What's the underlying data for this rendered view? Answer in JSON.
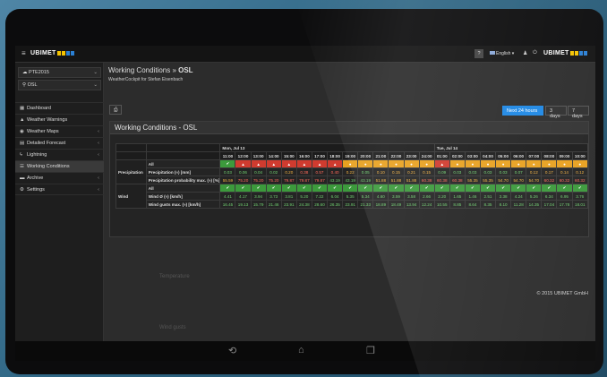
{
  "topbar": {
    "menu_icon": "menu-icon",
    "logo_text": "UBIMET",
    "help_label": "?",
    "language": "English",
    "footer_logo": "UBIMET"
  },
  "sidebar": {
    "select1": "PTE2015",
    "select2": "OSL",
    "items": [
      {
        "label": "Dashboard",
        "icon": "grid-icon"
      },
      {
        "label": "Weather Warnings",
        "icon": "warning-icon"
      },
      {
        "label": "Weather Maps",
        "icon": "globe-icon"
      },
      {
        "label": "Detailed Forecast",
        "icon": "calendar-icon"
      },
      {
        "label": "Lightning",
        "icon": "lightning-icon"
      },
      {
        "label": "Working Conditions",
        "icon": "list-icon"
      },
      {
        "label": "Archive",
        "icon": "archive-icon"
      },
      {
        "label": "Settings",
        "icon": "cogs-icon"
      }
    ]
  },
  "page": {
    "title_prefix": "Working Conditions » ",
    "title_strong": "OSL",
    "subtitle": "WeatherCockpit for Stefan Eisenbach"
  },
  "toolbar": {
    "print_icon": "print-icon",
    "range_buttons": [
      "Next 24 hours",
      "3 days",
      "7 days"
    ]
  },
  "panel": {
    "title": "Working Conditions - OSL",
    "day1": "Mon, Jul 13",
    "day2": "Tue, Jul 14",
    "hours": [
      "11:00",
      "12:00",
      "13:00",
      "14:00",
      "15:00",
      "16:00",
      "17:00",
      "18:00",
      "19:00",
      "20:00",
      "21:00",
      "22:00",
      "23:00",
      "24:00",
      "01:00",
      "02:00",
      "03:00",
      "04:00",
      "05:00",
      "06:00",
      "07:00",
      "08:00",
      "09:00",
      "10:00"
    ],
    "precip_group": "Precipitation",
    "all_label": "All",
    "precip_row_label": "Precipitation (≈) [mm]",
    "precip_values": [
      "0.03",
      "0.06",
      "0.04",
      "0.02",
      "0.20",
      "0.38",
      "0.57",
      "0.40",
      "0.22",
      "0.05",
      "0.10",
      "0.15",
      "0.21",
      "0.15",
      "0.09",
      "0.03",
      "0.03",
      "0.03",
      "0.03",
      "0.07",
      "0.12",
      "0.17",
      "0.14",
      "0.12"
    ],
    "prob_row_label": "Precipitation probability max. (≈) [%]",
    "prob_values": [
      "55.59",
      "75.20",
      "75.20",
      "75.20",
      "79.87",
      "79.87",
      "79.87",
      "43.19",
      "43.19",
      "43.19",
      "51.88",
      "51.88",
      "51.88",
      "60.38",
      "60.38",
      "60.38",
      "55.35",
      "55.35",
      "54.70",
      "54.70",
      "54.70",
      "60.32",
      "60.32",
      "60.32"
    ],
    "wind_group": "Wind",
    "wind_row_label": "Wind Ø (≈) [km/h]",
    "wind_values": [
      "4.41",
      "4.17",
      "3.94",
      "3.73",
      "3.81",
      "5.20",
      "7.22",
      "6.04",
      "5.35",
      "5.34",
      "4.60",
      "3.59",
      "3.58",
      "2.66",
      "2.20",
      "1.65",
      "1.46",
      "2.51",
      "3.38",
      "4.24",
      "5.26",
      "6.34",
      "6.95",
      "3.76"
    ],
    "gust_row_label": "Wind gusts max. (≈) [km/h]",
    "gust_values": [
      "16.45",
      "19.13",
      "15.79",
      "21.46",
      "23.91",
      "24.38",
      "28.60",
      "26.35",
      "23.91",
      "21.33",
      "18.89",
      "18.49",
      "13.94",
      "12.24",
      "10.55",
      "8.85",
      "8.64",
      "8.35",
      "8.10",
      "11.28",
      "14.35",
      "17.04",
      "17.78",
      "18.01"
    ],
    "ghost_temperature": "Temperature",
    "ghost_windgusts": "Wind gusts"
  },
  "footer": {
    "copyright": "© 2015 UBIMET GmbH"
  },
  "colors": {
    "ok": "#3c9a3c",
    "warn": "#e8a120",
    "bad": "#d03b2f",
    "accent": "#1e88e5"
  }
}
